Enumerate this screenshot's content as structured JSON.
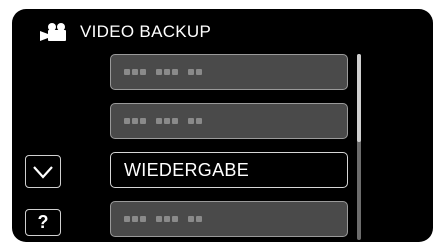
{
  "header": {
    "title": "VIDEO BACKUP",
    "icon": "video-camera-icon"
  },
  "menu": {
    "items": [
      {
        "label": "",
        "masked": true
      },
      {
        "label": "",
        "masked": true
      },
      {
        "label": "WIEDERGABE",
        "masked": false,
        "selected": true
      },
      {
        "label": "",
        "masked": true
      }
    ]
  },
  "buttons": {
    "down_icon": "chevron-down-icon",
    "help_label": "?"
  },
  "colors": {
    "background": "#000000",
    "item_bg": "#4a4a4a",
    "text": "#ffffff",
    "border": "#d0d0d0"
  }
}
